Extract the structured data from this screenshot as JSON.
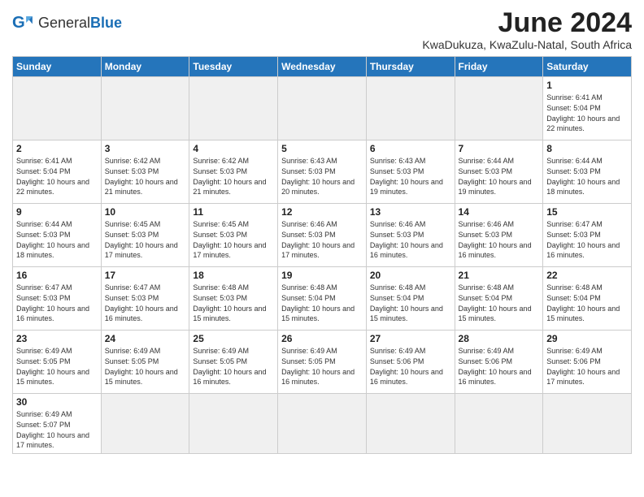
{
  "logo": {
    "general": "General",
    "blue": "Blue"
  },
  "title": "June 2024",
  "location": "KwaDukuza, KwaZulu-Natal, South Africa",
  "headers": [
    "Sunday",
    "Monday",
    "Tuesday",
    "Wednesday",
    "Thursday",
    "Friday",
    "Saturday"
  ],
  "week0": [
    {
      "day": "",
      "info": "",
      "empty": true
    },
    {
      "day": "",
      "info": "",
      "empty": true
    },
    {
      "day": "",
      "info": "",
      "empty": true
    },
    {
      "day": "",
      "info": "",
      "empty": true
    },
    {
      "day": "",
      "info": "",
      "empty": true
    },
    {
      "day": "",
      "info": "",
      "empty": true
    },
    {
      "day": "1",
      "info": "Sunrise: 6:41 AM\nSunset: 5:04 PM\nDaylight: 10 hours\nand 22 minutes."
    }
  ],
  "week1": [
    {
      "day": "2",
      "info": "Sunrise: 6:41 AM\nSunset: 5:04 PM\nDaylight: 10 hours\nand 22 minutes."
    },
    {
      "day": "3",
      "info": "Sunrise: 6:42 AM\nSunset: 5:03 PM\nDaylight: 10 hours\nand 21 minutes."
    },
    {
      "day": "4",
      "info": "Sunrise: 6:42 AM\nSunset: 5:03 PM\nDaylight: 10 hours\nand 21 minutes."
    },
    {
      "day": "5",
      "info": "Sunrise: 6:43 AM\nSunset: 5:03 PM\nDaylight: 10 hours\nand 20 minutes."
    },
    {
      "day": "6",
      "info": "Sunrise: 6:43 AM\nSunset: 5:03 PM\nDaylight: 10 hours\nand 19 minutes."
    },
    {
      "day": "7",
      "info": "Sunrise: 6:44 AM\nSunset: 5:03 PM\nDaylight: 10 hours\nand 19 minutes."
    },
    {
      "day": "8",
      "info": "Sunrise: 6:44 AM\nSunset: 5:03 PM\nDaylight: 10 hours\nand 18 minutes."
    }
  ],
  "week2": [
    {
      "day": "9",
      "info": "Sunrise: 6:44 AM\nSunset: 5:03 PM\nDaylight: 10 hours\nand 18 minutes."
    },
    {
      "day": "10",
      "info": "Sunrise: 6:45 AM\nSunset: 5:03 PM\nDaylight: 10 hours\nand 17 minutes."
    },
    {
      "day": "11",
      "info": "Sunrise: 6:45 AM\nSunset: 5:03 PM\nDaylight: 10 hours\nand 17 minutes."
    },
    {
      "day": "12",
      "info": "Sunrise: 6:46 AM\nSunset: 5:03 PM\nDaylight: 10 hours\nand 17 minutes."
    },
    {
      "day": "13",
      "info": "Sunrise: 6:46 AM\nSunset: 5:03 PM\nDaylight: 10 hours\nand 16 minutes."
    },
    {
      "day": "14",
      "info": "Sunrise: 6:46 AM\nSunset: 5:03 PM\nDaylight: 10 hours\nand 16 minutes."
    },
    {
      "day": "15",
      "info": "Sunrise: 6:47 AM\nSunset: 5:03 PM\nDaylight: 10 hours\nand 16 minutes."
    }
  ],
  "week3": [
    {
      "day": "16",
      "info": "Sunrise: 6:47 AM\nSunset: 5:03 PM\nDaylight: 10 hours\nand 16 minutes."
    },
    {
      "day": "17",
      "info": "Sunrise: 6:47 AM\nSunset: 5:03 PM\nDaylight: 10 hours\nand 16 minutes."
    },
    {
      "day": "18",
      "info": "Sunrise: 6:48 AM\nSunset: 5:03 PM\nDaylight: 10 hours\nand 15 minutes."
    },
    {
      "day": "19",
      "info": "Sunrise: 6:48 AM\nSunset: 5:04 PM\nDaylight: 10 hours\nand 15 minutes."
    },
    {
      "day": "20",
      "info": "Sunrise: 6:48 AM\nSunset: 5:04 PM\nDaylight: 10 hours\nand 15 minutes."
    },
    {
      "day": "21",
      "info": "Sunrise: 6:48 AM\nSunset: 5:04 PM\nDaylight: 10 hours\nand 15 minutes."
    },
    {
      "day": "22",
      "info": "Sunrise: 6:48 AM\nSunset: 5:04 PM\nDaylight: 10 hours\nand 15 minutes."
    }
  ],
  "week4": [
    {
      "day": "23",
      "info": "Sunrise: 6:49 AM\nSunset: 5:05 PM\nDaylight: 10 hours\nand 15 minutes."
    },
    {
      "day": "24",
      "info": "Sunrise: 6:49 AM\nSunset: 5:05 PM\nDaylight: 10 hours\nand 15 minutes."
    },
    {
      "day": "25",
      "info": "Sunrise: 6:49 AM\nSunset: 5:05 PM\nDaylight: 10 hours\nand 16 minutes."
    },
    {
      "day": "26",
      "info": "Sunrise: 6:49 AM\nSunset: 5:05 PM\nDaylight: 10 hours\nand 16 minutes."
    },
    {
      "day": "27",
      "info": "Sunrise: 6:49 AM\nSunset: 5:06 PM\nDaylight: 10 hours\nand 16 minutes."
    },
    {
      "day": "28",
      "info": "Sunrise: 6:49 AM\nSunset: 5:06 PM\nDaylight: 10 hours\nand 16 minutes."
    },
    {
      "day": "29",
      "info": "Sunrise: 6:49 AM\nSunset: 5:06 PM\nDaylight: 10 hours\nand 17 minutes."
    }
  ],
  "week5": [
    {
      "day": "30",
      "info": "Sunrise: 6:49 AM\nSunset: 5:07 PM\nDaylight: 10 hours\nand 17 minutes."
    },
    {
      "day": "",
      "info": "",
      "empty": true
    },
    {
      "day": "",
      "info": "",
      "empty": true
    },
    {
      "day": "",
      "info": "",
      "empty": true
    },
    {
      "day": "",
      "info": "",
      "empty": true
    },
    {
      "day": "",
      "info": "",
      "empty": true
    },
    {
      "day": "",
      "info": "",
      "empty": true
    }
  ]
}
